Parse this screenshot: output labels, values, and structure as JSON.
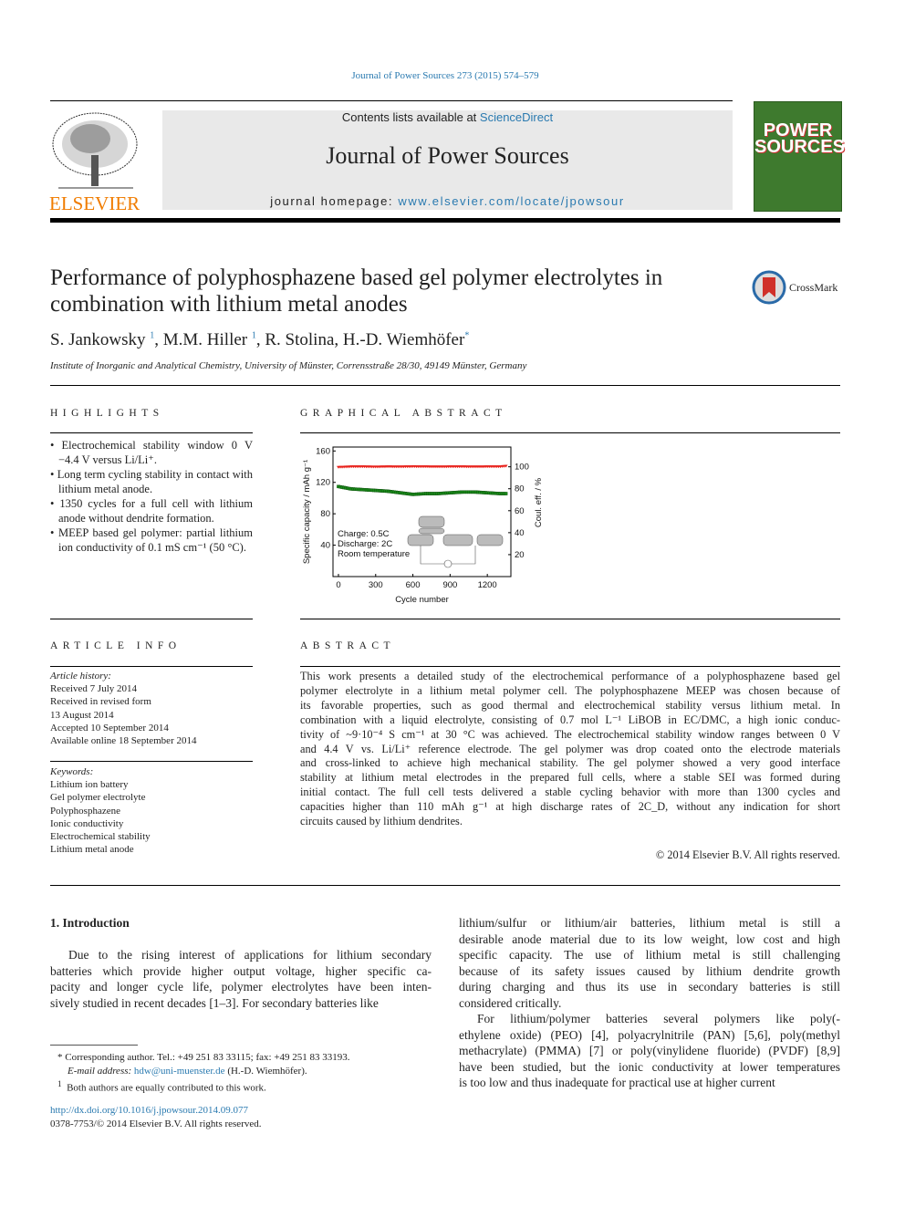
{
  "journal_ref": "Journal of Power Sources 273 (2015) 574–579",
  "banner": {
    "contents_prefix": "Contents lists available at ",
    "contents_link": "ScienceDirect",
    "journal_title": "Journal of Power Sources",
    "homepage_prefix": "journal homepage: ",
    "homepage_link": "www.elsevier.com/locate/jpowsour",
    "publisher_logo": "ELSEVIER",
    "cover_text": "POWER SOURCES",
    "cover_color": "#3e7a2e",
    "elsevier_color": "#f07c00"
  },
  "article": {
    "title_line1": "Performance of polyphosphazene based gel polymer electrolytes in",
    "title_line2": "combination with lithium metal anodes",
    "crossmark": "CrossMark",
    "authors": [
      {
        "name": "S. Jankowsky",
        "mark": "1"
      },
      {
        "name": "M.M. Hiller",
        "mark": "1"
      },
      {
        "name": "R. Stolina",
        "mark": ""
      },
      {
        "name": "H.-D. Wiemhöfer",
        "mark": "*"
      }
    ],
    "affiliation": "Institute of Inorganic and Analytical Chemistry, University of Münster, Corrensstraße 28/30, 49149 Münster, Germany"
  },
  "highlights": {
    "heading": "HIGHLIGHTS",
    "items": [
      "Electrochemical stability window 0 V −4.4 V versus Li/Li⁺.",
      "Long term cycling stability in contact with lithium metal anode.",
      "1350 cycles for a full cell with lithium anode without dendrite formation.",
      "MEEP based gel polymer: partial lithium ion conductivity of 0.1 mS cm⁻¹ (50 °C)."
    ]
  },
  "graphical_abstract": {
    "heading": "GRAPHICAL ABSTRACT"
  },
  "chart_data": {
    "type": "scatter",
    "title": "",
    "xlabel": "Cycle number",
    "ylabel": "Specific capacity / mAh g⁻¹",
    "y2label": "Coul. eff. / %",
    "xlim": [
      -44,
      1390
    ],
    "ylim": [
      0,
      165
    ],
    "y2lim": [
      0,
      118
    ],
    "xticks": [
      "0",
      "300",
      "600",
      "900",
      "1200"
    ],
    "yticks": [
      "40",
      "80",
      "120",
      "160"
    ],
    "y2ticks": [
      "20",
      "40",
      "60",
      "80",
      "100"
    ],
    "annotations": [
      "Charge: 0.5C",
      "Discharge: 2C",
      "Room temperature"
    ],
    "grid": false,
    "x": [
      0,
      100,
      200,
      300,
      400,
      500,
      600,
      700,
      800,
      900,
      1000,
      1100,
      1200,
      1300,
      1350
    ],
    "series": [
      {
        "axis": "left",
        "color": "#1a8a1a",
        "values": [
          114,
          111,
          110,
          109,
          108,
          106,
          104,
          105,
          105,
          106,
          107,
          107,
          106,
          105,
          105
        ]
      },
      {
        "axis": "right",
        "color": "#e8201a",
        "values": [
          99,
          99.5,
          99.5,
          99.3,
          99.5,
          99.4,
          99.6,
          99.5,
          99.4,
          99.5,
          99.5,
          99.4,
          99.5,
          99.5,
          100
        ]
      }
    ]
  },
  "article_info": {
    "heading": "ARTICLE INFO",
    "history_label": "Article history:",
    "history": [
      "Received 7 July 2014",
      "Received in revised form",
      "13 August 2014",
      "Accepted 10 September 2014",
      "Available online 18 September 2014"
    ],
    "keywords_label": "Keywords:",
    "keywords": [
      "Lithium ion battery",
      "Gel polymer electrolyte",
      "Polyphosphazene",
      "Ionic conductivity",
      "Electrochemical stability",
      "Lithium metal anode"
    ]
  },
  "abstract": {
    "heading": "ABSTRACT",
    "lines": [
      "This work presents a detailed study of the electrochemical performance of a polyphosphazene based gel",
      "polymer electrolyte in a lithium metal polymer cell. The polyphosphazene MEEP was chosen because of",
      "its favorable properties, such as good thermal and electrochemical stability versus lithium metal. In",
      "combination with a liquid electrolyte, consisting of 0.7 mol L⁻¹ LiBOB in EC/DMC, a high ionic conduc-",
      "tivity of ~9·10⁻⁴ S cm⁻¹ at 30 °C was achieved. The electrochemical stability window ranges between 0 V",
      "and 4.4 V vs. Li/Li⁺ reference electrode. The gel polymer was drop coated onto the electrode materials",
      "and cross-linked to achieve high mechanical stability. The gel polymer showed a very good interface",
      "stability at lithium metal electrodes in the prepared full cells, where a stable SEI was formed during",
      "initial contact. The full cell tests delivered a stable cycling behavior with more than 1300 cycles and",
      "capacities higher than 110 mAh g⁻¹ at high discharge rates of 2C_D, without any indication for short",
      "circuits caused by lithium dendrites."
    ],
    "copyright": "© 2014 Elsevier B.V. All rights reserved."
  },
  "intro": {
    "heading": "1.  Introduction",
    "left_lines": [
      "Due to the rising interest of applications for lithium secondary",
      "batteries which provide higher output voltage, higher specific ca-",
      "pacity and longer cycle life, polymer electrolytes have been inten-",
      "sively studied in recent decades [1–3]. For secondary batteries like"
    ],
    "right_lines": [
      "lithium/sulfur or lithium/air batteries, lithium metal is still a",
      "desirable anode material due to its low weight, low cost and high",
      "specific capacity. The use of lithium metal is still challenging",
      "because of its safety issues caused by lithium dendrite growth",
      "during charging and thus its use in secondary batteries is still",
      "considered critically.",
      "For lithium/polymer batteries several polymers like poly(-",
      "ethylene oxide) (PEO) [4], polyacrylnitrile (PAN) [5,6], poly(methyl",
      "methacrylate) (PMMA) [7] or poly(vinylidene fluoride) (PVDF) [8,9]",
      "have been studied, but the ionic conductivity at lower temperatures",
      "is too low and thus inadequate for practical use at higher current"
    ]
  },
  "footnotes": {
    "corresponding": "Corresponding author. Tel.: +49 251 83 33115; fax: +49 251 83 33193.",
    "email_label": "E-mail address: ",
    "email": "hdw@uni-muenster.de",
    "email_suffix": " (H.-D. Wiemhöfer).",
    "note1": "Both authors are equally contributed to this work."
  },
  "footer": {
    "doi": "http://dx.doi.org/10.1016/j.jpowsour.2014.09.077",
    "issn": "0378-7753/© 2014 Elsevier B.V. All rights reserved."
  }
}
